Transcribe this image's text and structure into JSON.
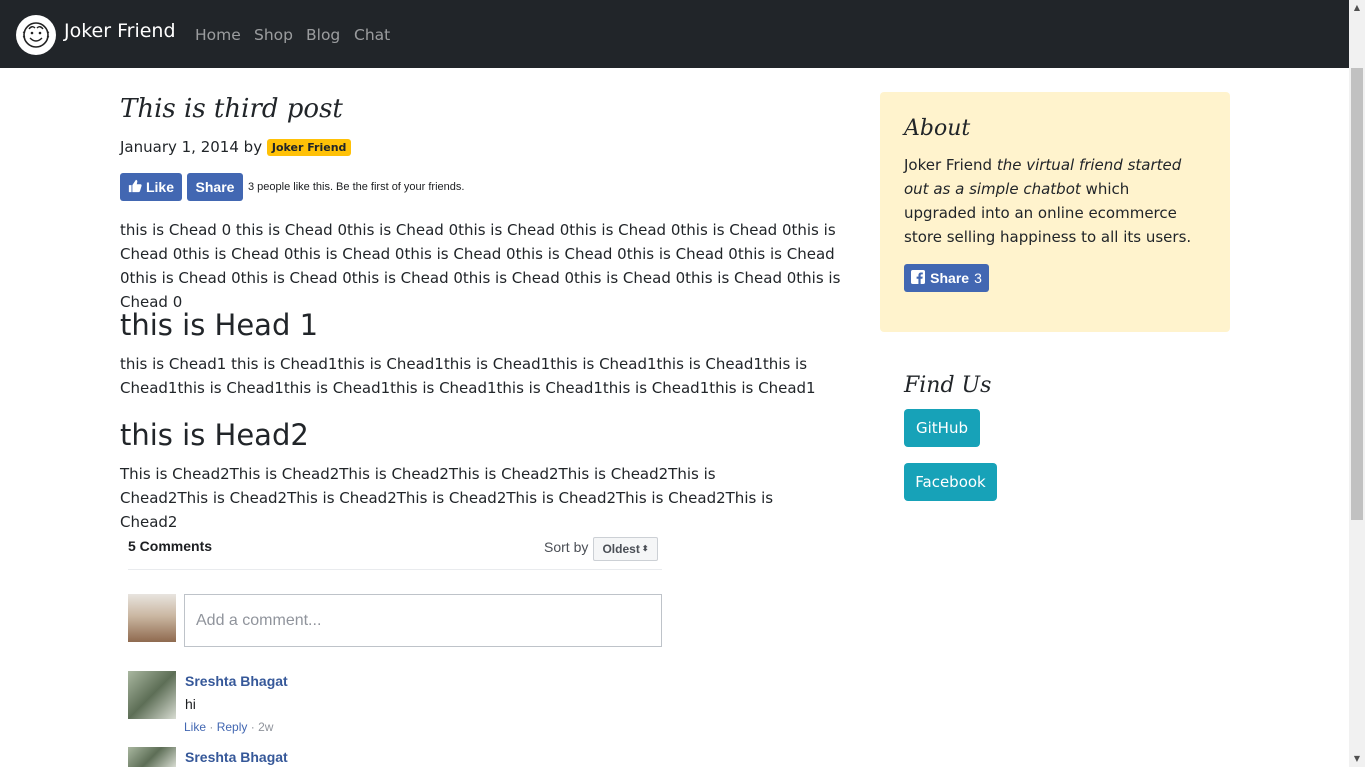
{
  "navbar": {
    "brand": "Joker Friend",
    "links": [
      "Home",
      "Shop",
      "Blog",
      "Chat"
    ]
  },
  "post": {
    "title": "This is third post",
    "date": "January 1, 2014",
    "by": "by",
    "author": "Joker Friend",
    "fb_like_label": "Like",
    "fb_share_label": "Share",
    "fb_like_text": "3 people like this. Be the first of your friends.",
    "para0": "this is Chead 0 this is Chead 0this is Chead 0this is Chead 0this is Chead 0this is Chead 0this is Chead 0this is Chead 0this is Chead 0this is Chead 0this is Chead 0this is Chead 0this is Chead 0this is Chead 0this is Chead 0this is Chead 0this is Chead 0this is Chead 0this is Chead 0this is Chead 0",
    "heading1": "this is Head 1",
    "para1": "this is Chead1 this is Chead1this is Chead1this is Chead1this is Chead1this is Chead1this is Chead1this is Chead1this is Chead1this is Chead1this is Chead1this is Chead1this is Chead1",
    "heading2": "this is Head2",
    "para2": "This is Chead2This is Chead2This is Chead2This is Chead2This is Chead2This is Chead2This is Chead2This is Chead2This is Chead2This is Chead2This is Chead2This is Chead2"
  },
  "comments": {
    "count_label": "5 Comments",
    "sort_label": "Sort by",
    "sort_value": "Oldest",
    "input_placeholder": "Add a comment...",
    "items": [
      {
        "author": "Sreshta Bhagat",
        "text": "hi",
        "like": "Like",
        "reply": "Reply",
        "time": "2w"
      },
      {
        "author": "Sreshta Bhagat"
      }
    ]
  },
  "sidebar": {
    "about_title": "About",
    "about_brand": "Joker Friend",
    "about_italic": "the virtual friend started out as a simple chatbot",
    "about_rest": "which upgraded into an online ecommerce store selling happiness to all its users.",
    "share_label": "Share",
    "share_count": "3",
    "findus_title": "Find Us",
    "github": "GitHub",
    "facebook": "Facebook"
  },
  "icons": {
    "logo": "smiley-face-icon",
    "like": "thumbs-up-icon",
    "facebook": "facebook-f-icon",
    "sort": "sort-arrows-icon"
  },
  "colors": {
    "navbar": "#212529",
    "fb_blue": "#4267b2",
    "badge": "#ffc107",
    "about_bg": "#fff3cd",
    "teal": "#17a2b8"
  }
}
